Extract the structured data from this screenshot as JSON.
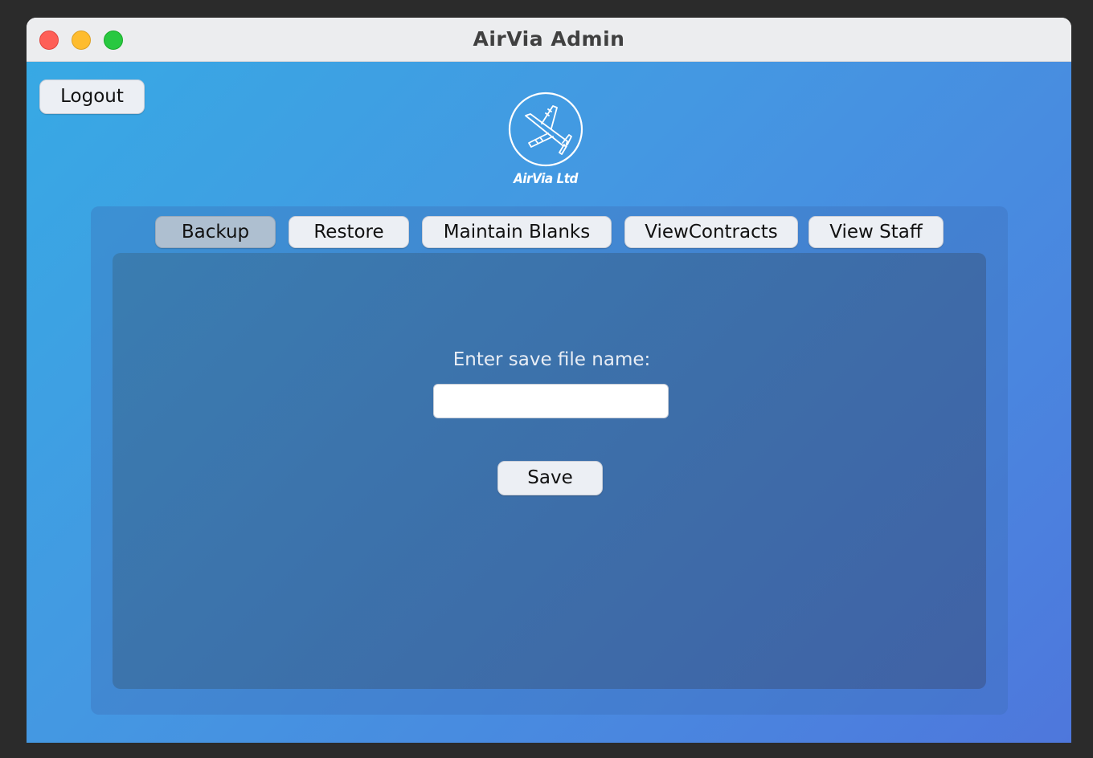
{
  "window": {
    "title": "AirVia Admin"
  },
  "header": {
    "logout_label": "Logout",
    "logo_text": "AirVia Ltd",
    "logo_icon": "airplane-icon"
  },
  "tabs": [
    {
      "label": "Backup",
      "selected": true
    },
    {
      "label": "Restore",
      "selected": false
    },
    {
      "label": "Maintain Blanks",
      "selected": false
    },
    {
      "label": "ViewContracts",
      "selected": false
    },
    {
      "label": "View Staff",
      "selected": false
    }
  ],
  "backup": {
    "prompt": "Enter save file name:",
    "filename_value": "",
    "save_label": "Save"
  },
  "colors": {
    "gradient_start": "#37a9e4",
    "gradient_end": "#4e77dc",
    "button_bg": "#eceff4",
    "selected_tab_bg": "#aebfd0"
  }
}
